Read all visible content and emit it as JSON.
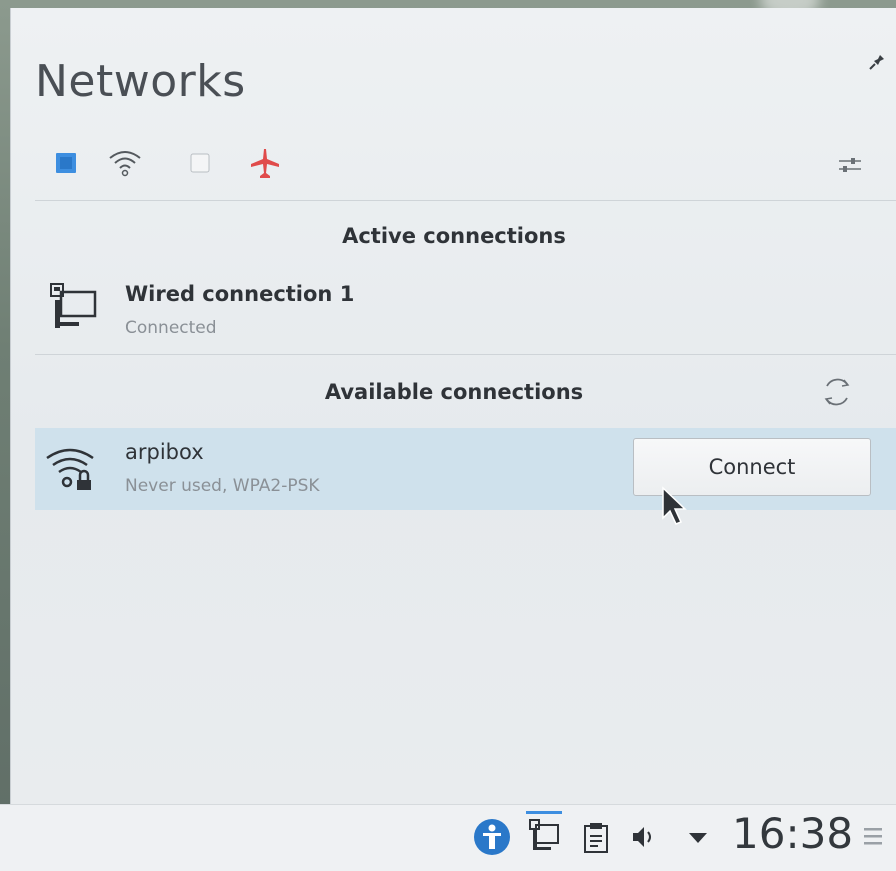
{
  "applet": {
    "title": "Networks"
  },
  "sections": {
    "active_title": "Active connections",
    "available_title": "Available connections"
  },
  "active_connections": [
    {
      "name": "Wired connection 1",
      "status": "Connected",
      "icon": "wired-monitor-icon"
    }
  ],
  "available_connections": [
    {
      "name": "arpibox",
      "details": "Never used, WPA2-PSK",
      "icon": "wifi-locked-icon",
      "action_label": "Connect",
      "selected": true
    }
  ],
  "toggles": [
    {
      "name": "wired-toggle",
      "state": "on"
    },
    {
      "name": "wifi-toggle",
      "state": "off"
    },
    {
      "name": "airplane-mode",
      "state": "off"
    }
  ],
  "taskbar": {
    "clock": "16:38",
    "tray_icons": [
      "accessibility-icon",
      "network-icon",
      "clipboard-icon",
      "volume-icon",
      "expand-arrow-icon"
    ]
  },
  "colors": {
    "accent": "#3d8ee0",
    "selection": "#cfe1ec",
    "airplane": "#e04b4b"
  }
}
